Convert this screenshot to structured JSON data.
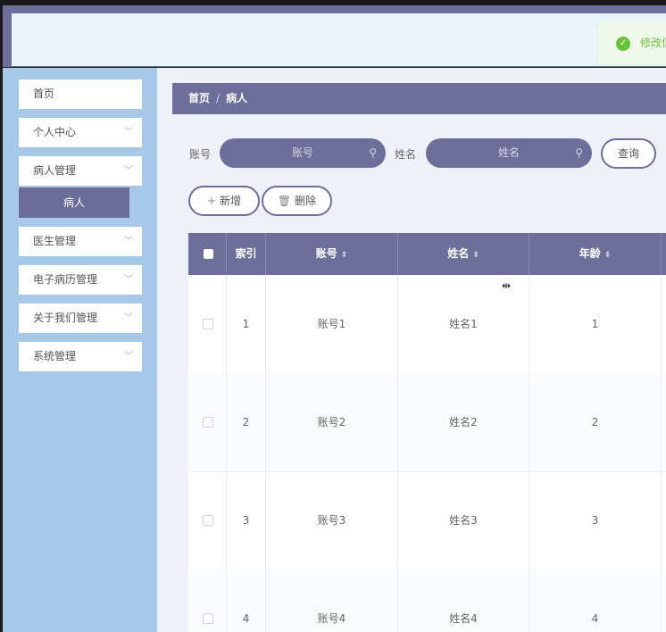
{
  "toast": {
    "icon": "check-circle-icon",
    "text": "修改信"
  },
  "sidebar": {
    "items": [
      {
        "label": "首页",
        "expandable": false
      },
      {
        "label": "个人中心",
        "expandable": true
      },
      {
        "label": "病人管理",
        "expandable": true
      },
      {
        "label": "医生管理",
        "expandable": true
      },
      {
        "label": "电子病历管理",
        "expandable": true
      },
      {
        "label": "关于我们管理",
        "expandable": true
      },
      {
        "label": "系统管理",
        "expandable": true
      }
    ],
    "active_sub": "病人"
  },
  "breadcrumb": {
    "home": "首页",
    "separator": "/",
    "current": "病人"
  },
  "search": {
    "account_label": "账号",
    "account_placeholder": "账号",
    "name_label": "姓名",
    "name_placeholder": "姓名",
    "query_button": "查询"
  },
  "actions": {
    "add": "新增",
    "delete": "删除"
  },
  "table": {
    "columns": [
      "索引",
      "账号",
      "姓名",
      "年龄"
    ],
    "rows": [
      {
        "index": "1",
        "account": "账号1",
        "name": "姓名1",
        "age": "1"
      },
      {
        "index": "2",
        "account": "账号2",
        "name": "姓名2",
        "age": "2"
      },
      {
        "index": "3",
        "account": "账号3",
        "name": "姓名3",
        "age": "3"
      },
      {
        "index": "4",
        "account": "账号4",
        "name": "姓名4",
        "age": "4"
      }
    ]
  },
  "colors": {
    "theme": "#6e6e9a",
    "sidebar_bg": "#a8c8e8",
    "header_bg": "#eaf4fd",
    "success": "#67c23a"
  }
}
